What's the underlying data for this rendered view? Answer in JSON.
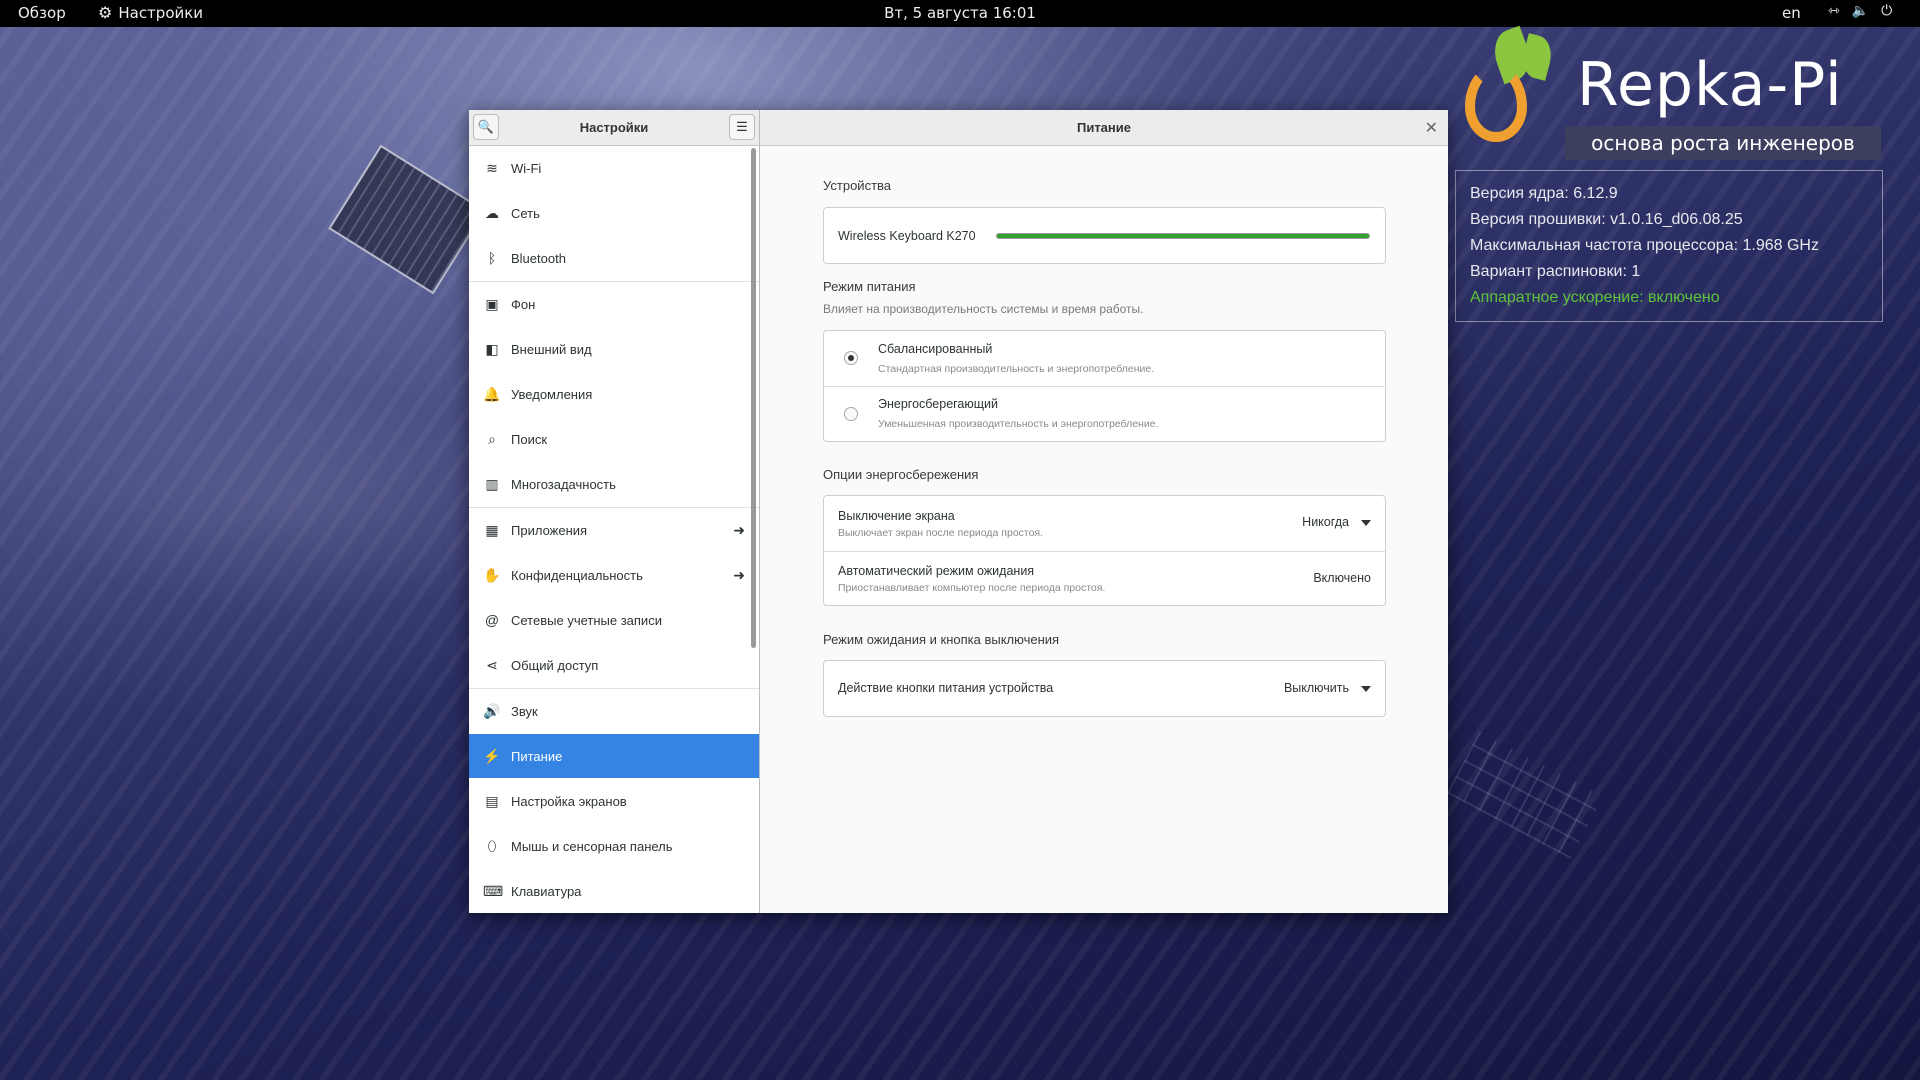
{
  "topbar": {
    "overview": "Обзор",
    "app_name": "Настройки",
    "clock": "Вт, 5 августа  16:01",
    "lang": "en",
    "icons": [
      "network-icon",
      "volume-icon",
      "power-icon"
    ]
  },
  "brand": {
    "name": "Repka-Pi",
    "tagline": "основа роста инженеров"
  },
  "sysinfo": {
    "kernel": "Версия ядра: 6.12.9",
    "firmware": "Версия прошивки: v1.0.16_d06.08.25",
    "cpu_freq": "Максимальная частота процессора: 1.968 GHz",
    "pinout": "Вариант распиновки: 1",
    "hw_accel": "Аппаратное ускорение: включено",
    "accent_color": "#5ec43a"
  },
  "window": {
    "left_title": "Настройки",
    "right_title": "Питание"
  },
  "sidebar": {
    "items": [
      {
        "label": "Wi-Fi",
        "icon": "wifi-icon"
      },
      {
        "label": "Сеть",
        "icon": "network-icon"
      },
      {
        "label": "Bluetooth",
        "icon": "bluetooth-icon"
      },
      {
        "label": "Фон",
        "icon": "background-icon"
      },
      {
        "label": "Внешний вид",
        "icon": "appearance-icon"
      },
      {
        "label": "Уведомления",
        "icon": "bell-icon"
      },
      {
        "label": "Поиск",
        "icon": "search-icon"
      },
      {
        "label": "Многозадачность",
        "icon": "multitasking-icon"
      },
      {
        "label": "Приложения",
        "icon": "apps-icon"
      },
      {
        "label": "Конфиденциальность",
        "icon": "hand-icon"
      },
      {
        "label": "Сетевые учетные записи",
        "icon": "at-icon"
      },
      {
        "label": "Общий доступ",
        "icon": "share-icon"
      },
      {
        "label": "Звук",
        "icon": "speaker-icon"
      },
      {
        "label": "Питание",
        "icon": "power-plug-icon"
      },
      {
        "label": "Настройка экранов",
        "icon": "display-icon"
      },
      {
        "label": "Мышь и сенсорная панель",
        "icon": "mouse-icon"
      },
      {
        "label": "Клавиатура",
        "icon": "keyboard-icon"
      }
    ],
    "active_color": "#3584e4"
  },
  "power": {
    "devices_title": "Устройства",
    "device_name": "Wireless Keyboard K270",
    "device_level": 1.0,
    "mode_title": "Режим питания",
    "mode_subtitle": "Влияет на производительность системы и время работы.",
    "modes": [
      {
        "label": "Сбалансированный",
        "desc": "Стандартная производительность и энергопотребление.",
        "selected": true
      },
      {
        "label": "Энергосберегающий",
        "desc": "Уменьшенная производительность и энергопотребление.",
        "selected": false
      }
    ],
    "saving_title": "Опции энергосбережения",
    "screen_off_label": "Выключение экрана",
    "screen_off_desc": "Выключает экран после периода простоя.",
    "screen_off_value": "Никогда",
    "auto_suspend_label": "Автоматический режим ожидания",
    "auto_suspend_desc": "Приостанавливает компьютер после периода простоя.",
    "auto_suspend_value": "Включено",
    "suspend_title": "Режим ожидания и кнопка выключения",
    "power_button_label": "Действие кнопки питания устройства",
    "power_button_value": "Выключить"
  }
}
